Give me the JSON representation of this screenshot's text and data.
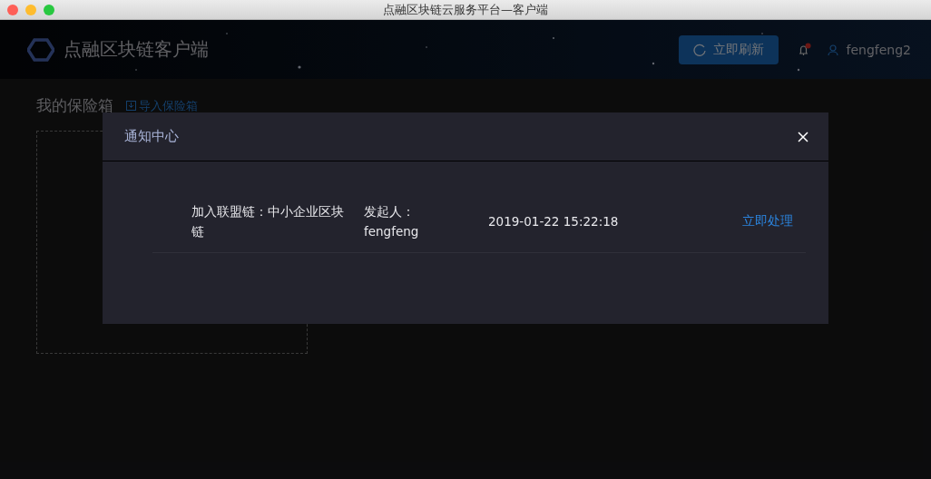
{
  "window": {
    "title": "点融区块链云服务平台—客户端"
  },
  "header": {
    "app_name": "点融区块链客户端",
    "refresh_button": "立即刷新",
    "notifications": {
      "unread": true
    },
    "username": "fengfeng2"
  },
  "page": {
    "title": "我的保险箱",
    "import_link": "导入保险箱"
  },
  "modal": {
    "title": "通知中心",
    "notifications": [
      {
        "message": "加入联盟链：中小企业区块链",
        "initiator": "发起人：fengfeng",
        "time": "2019-01-22 15:22:18",
        "action": "立即处理"
      }
    ]
  }
}
